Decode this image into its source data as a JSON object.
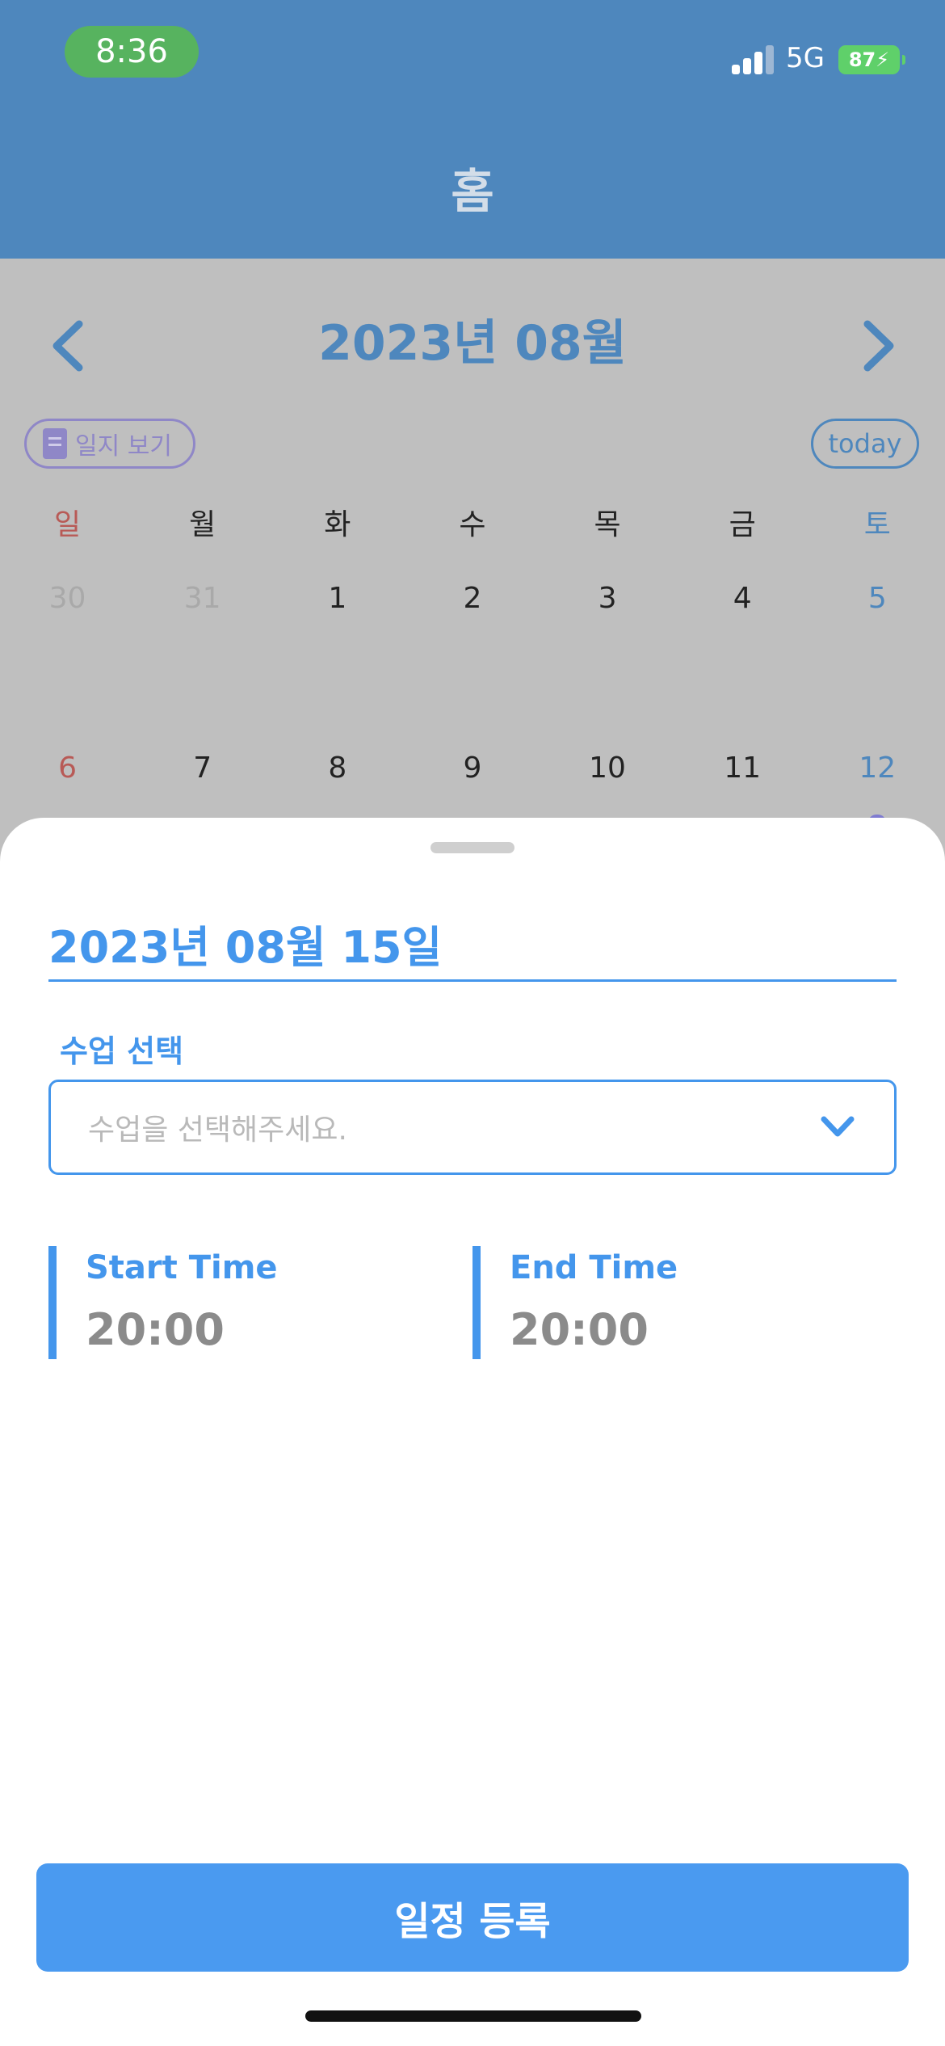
{
  "status_bar": {
    "time": "8:36",
    "network": "5G",
    "battery": "87"
  },
  "header": {
    "title": "홈"
  },
  "calendar": {
    "month_title": "2023년 08월",
    "diary_button": "일지 보기",
    "today_button": "today",
    "weekdays": [
      "일",
      "월",
      "화",
      "수",
      "목",
      "금",
      "토"
    ],
    "week1": [
      "30",
      "31",
      "1",
      "2",
      "3",
      "4",
      "5"
    ],
    "week2": [
      "6",
      "7",
      "8",
      "9",
      "10",
      "11",
      "12"
    ]
  },
  "sheet": {
    "selected_date": "2023년 08월 15일",
    "class_label": "수업 선택",
    "class_placeholder": "수업을 선택해주세요.",
    "start_label": "Start Time",
    "start_value": "20:00",
    "end_label": "End Time",
    "end_value": "20:00",
    "submit_label": "일정 등록"
  },
  "colors": {
    "header": "#4e87bd",
    "accent": "#4496ec",
    "button": "#4a9af0",
    "sunday": "#b85a56"
  }
}
